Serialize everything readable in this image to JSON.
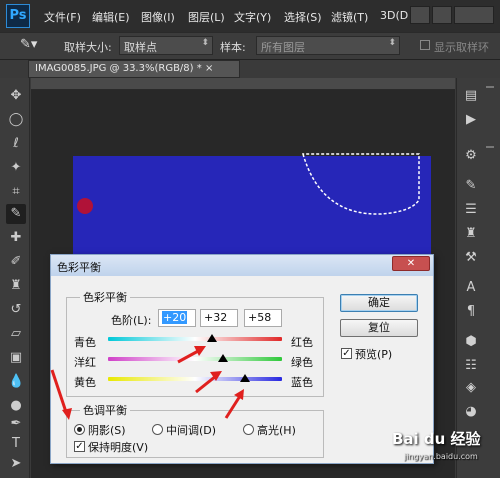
{
  "app": {
    "logo": "Ps"
  },
  "menu": [
    "文件(F)",
    "编辑(E)",
    "图像(I)",
    "图层(L)",
    "文字(Y)",
    "选择(S)",
    "滤镜(T)",
    "3D(D"
  ],
  "options": {
    "sample_size_label": "取样大小:",
    "sample_size_value": "取样点",
    "sample_label": "样本:",
    "sample_value": "所有图层",
    "show_ring_label": "显示取样环"
  },
  "document_tab": {
    "title": "IMAG0085.JPG @ 33.3%(RGB/8) *",
    "close": "×"
  },
  "dialog": {
    "title": "色彩平衡",
    "close_glyph": "✕",
    "color_balance_group": "色彩平衡",
    "levels_label": "色阶(L):",
    "levels": [
      "+20",
      "+32",
      "+58"
    ],
    "sliders": [
      {
        "left": "青色",
        "right": "红色",
        "value": 20
      },
      {
        "left": "洋红",
        "right": "绿色",
        "value": 32
      },
      {
        "left": "黄色",
        "right": "蓝色",
        "value": 58
      }
    ],
    "tone_group": "色调平衡",
    "tones": [
      "阴影(S)",
      "中间调(D)",
      "高光(H)"
    ],
    "selected_tone": "阴影(S)",
    "preserve_luminosity": "保持明度(V)",
    "ok": "确定",
    "reset": "复位",
    "preview": "预览(P)"
  },
  "watermark": {
    "text": "Bai du 经验",
    "sub": "jingyan.baidu.com"
  },
  "colors": {
    "image_blue": "#2626b8",
    "selected_arrows": "#e0201e"
  }
}
